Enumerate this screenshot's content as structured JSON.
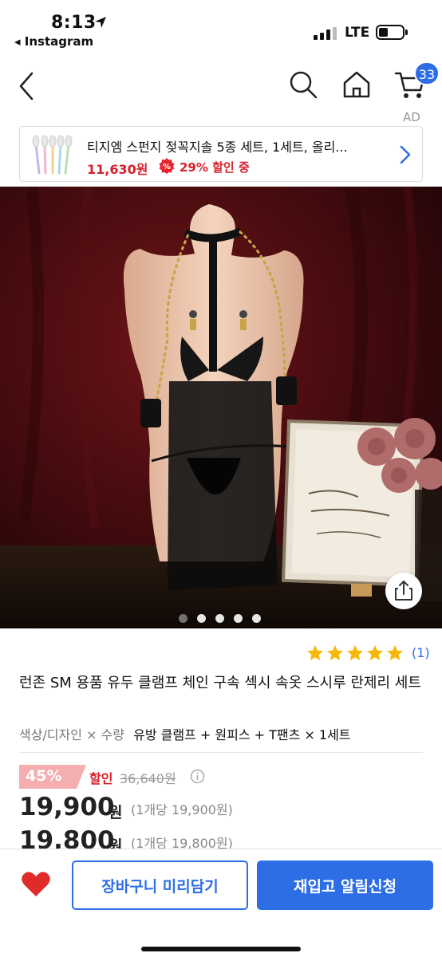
{
  "status_bar": {
    "time": "8:13",
    "back_app": "◂ Instagram",
    "network": "LTE",
    "location_icon": "location-arrow-icon",
    "signal_icon": "signal-bars-icon",
    "battery_icon": "battery-icon"
  },
  "nav": {
    "back_icon": "chevron-left-icon",
    "search_icon": "search-icon",
    "home_icon": "home-icon",
    "cart_icon": "cart-icon",
    "cart_badge": "33"
  },
  "ad": {
    "label": "AD",
    "title": "티지엠 스펀지 젖꼭지솔 5종 세트, 1세트, 올리...",
    "price": "11,630원",
    "discount": "29% 할인 중",
    "discount_icon": "percent-badge-icon",
    "arrow_icon": "chevron-right-icon"
  },
  "gallery": {
    "dot_count": 5,
    "active_dot": 0,
    "share_icon": "share-icon"
  },
  "product": {
    "rating_stars": 5,
    "review_count": "(1)",
    "title": "런존 SM 용품 유두 클램프 체인 구속 섹시 속옷 스시루 란제리 세트",
    "option_label": "색상/디자인 × 수량",
    "option_value": "유방 클램프 + 원피스 + T팬츠 × 1세트"
  },
  "pricing": {
    "discount_rate": "45%",
    "discount_word": "할인",
    "original_price": "36,640원",
    "price_primary": "19,900",
    "price_primary_unit": "원",
    "price_primary_per": "(1개당 19,900원)",
    "price_secondary": "19,800",
    "price_secondary_unit": "원",
    "price_secondary_per": "(1개당 19,800원)"
  },
  "actions": {
    "wishlist_icon": "heart-icon",
    "cart_button": "장바구니 미리담기",
    "notify_button": "재입고 알림신청"
  },
  "colors": {
    "accent": "#2d6ee6",
    "sale": "#d7202b",
    "badge": "#f4aeb0"
  }
}
